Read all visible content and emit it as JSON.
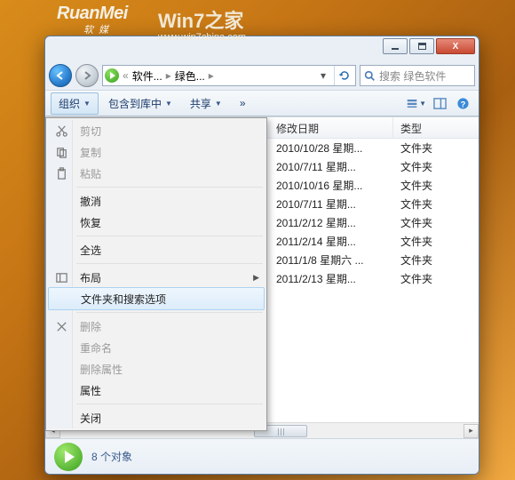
{
  "watermark": {
    "brand1": "RuanMei",
    "brand1_sub": "软媒",
    "brand2": "Win7之家",
    "url": "www.win7china.com"
  },
  "breadcrumb": {
    "seg1": "软件...",
    "seg2": "绿色...",
    "search_placeholder": "搜索 绿色软件"
  },
  "toolbar": {
    "organize": "组织",
    "include": "包含到库中",
    "share": "共享",
    "more": "»"
  },
  "columns": {
    "date": "修改日期",
    "type": "类型"
  },
  "type_folder": "文件夹",
  "rows": [
    {
      "date": "2010/10/28 星期..."
    },
    {
      "date": "2010/7/11 星期..."
    },
    {
      "date": "2010/10/16 星期..."
    },
    {
      "date": "2010/7/11 星期..."
    },
    {
      "date": "2011/2/12 星期..."
    },
    {
      "date": "2011/2/14 星期..."
    },
    {
      "date": "2011/1/8 星期六 ..."
    },
    {
      "date": "2011/2/13 星期..."
    }
  ],
  "menu": {
    "cut": "剪切",
    "copy": "复制",
    "paste": "粘贴",
    "undo": "撤消",
    "redo": "恢复",
    "select_all": "全选",
    "layout": "布局",
    "folder_options": "文件夹和搜索选项",
    "delete": "删除",
    "rename": "重命名",
    "remove_props": "删除属性",
    "properties": "属性",
    "close": "关闭"
  },
  "status": {
    "count": "8 个对象"
  }
}
